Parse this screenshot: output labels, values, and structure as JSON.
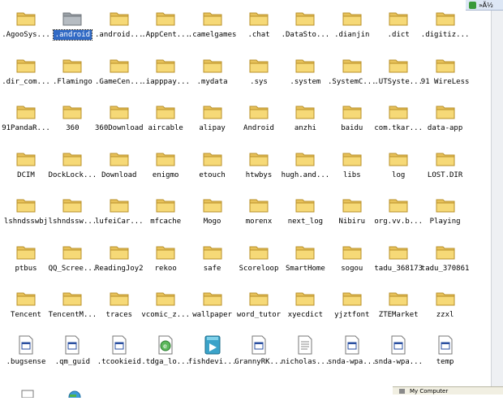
{
  "corner": {
    "text": "»Ã½"
  },
  "status_bar": {
    "text": "My Computer"
  },
  "items": [
    {
      "label": ".AgooSys...",
      "icon": "folder-icon"
    },
    {
      "label": ".android",
      "icon": "folder-hidden-icon",
      "selected": true
    },
    {
      "label": ".android...",
      "icon": "folder-icon"
    },
    {
      "label": ".AppCent...",
      "icon": "folder-icon"
    },
    {
      "label": ".camelgames",
      "icon": "folder-icon"
    },
    {
      "label": ".chat",
      "icon": "folder-icon"
    },
    {
      "label": ".DataSto...",
      "icon": "folder-icon"
    },
    {
      "label": ".dianjin",
      "icon": "folder-icon"
    },
    {
      "label": ".dict",
      "icon": "folder-icon"
    },
    {
      "label": ".digitiz...",
      "icon": "folder-icon"
    },
    {
      "label": ".dir_com...",
      "icon": "folder-icon"
    },
    {
      "label": ".Flamingo",
      "icon": "folder-icon"
    },
    {
      "label": ".GameCen...",
      "icon": "folder-icon"
    },
    {
      "label": ".iapppay...",
      "icon": "folder-icon"
    },
    {
      "label": ".mydata",
      "icon": "folder-icon"
    },
    {
      "label": ".sys",
      "icon": "folder-icon"
    },
    {
      "label": ".system",
      "icon": "folder-icon"
    },
    {
      "label": ".SystemC...",
      "icon": "folder-icon"
    },
    {
      "label": ".UTSyste...",
      "icon": "folder-icon"
    },
    {
      "label": "91 WireLess",
      "icon": "folder-icon"
    },
    {
      "label": "91PandaR...",
      "icon": "folder-icon"
    },
    {
      "label": "360",
      "icon": "folder-icon"
    },
    {
      "label": "360Download",
      "icon": "folder-icon"
    },
    {
      "label": "aircable",
      "icon": "folder-icon"
    },
    {
      "label": "alipay",
      "icon": "folder-icon"
    },
    {
      "label": "Android",
      "icon": "folder-icon"
    },
    {
      "label": "anzhi",
      "icon": "folder-icon"
    },
    {
      "label": "baidu",
      "icon": "folder-icon"
    },
    {
      "label": "com.tkar...",
      "icon": "folder-icon"
    },
    {
      "label": "data-app",
      "icon": "folder-icon"
    },
    {
      "label": "DCIM",
      "icon": "folder-icon"
    },
    {
      "label": "DockLock...",
      "icon": "folder-icon"
    },
    {
      "label": "Download",
      "icon": "folder-icon"
    },
    {
      "label": "enigmo",
      "icon": "folder-icon"
    },
    {
      "label": "etouch",
      "icon": "folder-icon"
    },
    {
      "label": "htwbys",
      "icon": "folder-icon"
    },
    {
      "label": "hugh.and...",
      "icon": "folder-icon"
    },
    {
      "label": "libs",
      "icon": "folder-icon"
    },
    {
      "label": "log",
      "icon": "folder-icon"
    },
    {
      "label": "LOST.DIR",
      "icon": "folder-icon"
    },
    {
      "label": "lshndsswbj",
      "icon": "folder-icon"
    },
    {
      "label": "lshndssw...",
      "icon": "folder-icon"
    },
    {
      "label": "lufeiCar...",
      "icon": "folder-icon"
    },
    {
      "label": "mfcache",
      "icon": "folder-icon"
    },
    {
      "label": "Mogo",
      "icon": "folder-icon"
    },
    {
      "label": "morenx",
      "icon": "folder-icon"
    },
    {
      "label": "next_log",
      "icon": "folder-icon"
    },
    {
      "label": "Nibiru",
      "icon": "folder-icon"
    },
    {
      "label": "org.vv.b...",
      "icon": "folder-icon"
    },
    {
      "label": "Playing",
      "icon": "folder-icon"
    },
    {
      "label": "ptbus",
      "icon": "folder-icon"
    },
    {
      "label": "QQ_Scree...",
      "icon": "folder-icon"
    },
    {
      "label": "ReadingJoy2",
      "icon": "folder-icon"
    },
    {
      "label": "rekoo",
      "icon": "folder-icon"
    },
    {
      "label": "safe",
      "icon": "folder-icon"
    },
    {
      "label": "Scoreloop",
      "icon": "folder-icon"
    },
    {
      "label": "SmartHome",
      "icon": "folder-icon"
    },
    {
      "label": "sogou",
      "icon": "folder-icon"
    },
    {
      "label": "tadu_368173",
      "icon": "folder-icon"
    },
    {
      "label": "tadu_370861",
      "icon": "folder-icon"
    },
    {
      "label": "Tencent",
      "icon": "folder-icon"
    },
    {
      "label": "TencentM...",
      "icon": "folder-icon"
    },
    {
      "label": "traces",
      "icon": "folder-icon"
    },
    {
      "label": "vcomic_z...",
      "icon": "folder-icon"
    },
    {
      "label": "wallpaper",
      "icon": "folder-icon"
    },
    {
      "label": "word_tutor",
      "icon": "folder-icon"
    },
    {
      "label": "xyecdict",
      "icon": "folder-icon"
    },
    {
      "label": "yjztfont",
      "icon": "folder-icon"
    },
    {
      "label": "ZTEMarket",
      "icon": "folder-icon"
    },
    {
      "label": "zzxl",
      "icon": "folder-icon"
    },
    {
      "label": ".bugsense",
      "icon": "window-file-icon"
    },
    {
      "label": ".qm_guid",
      "icon": "window-file-icon"
    },
    {
      "label": ".tcookieid",
      "icon": "window-file-icon"
    },
    {
      "label": ".tdga_lo...",
      "icon": "ie-file-icon"
    },
    {
      "label": "fishdevi...",
      "icon": "mpg-file-icon"
    },
    {
      "label": "GrannyRK...",
      "icon": "window-file-icon"
    },
    {
      "label": "nicholas...",
      "icon": "text-file-icon"
    },
    {
      "label": "snda-wpa...",
      "icon": "window-file-icon"
    },
    {
      "label": "snda-wpa...",
      "icon": "window-file-icon"
    },
    {
      "label": "temp",
      "icon": "window-file-icon"
    }
  ]
}
